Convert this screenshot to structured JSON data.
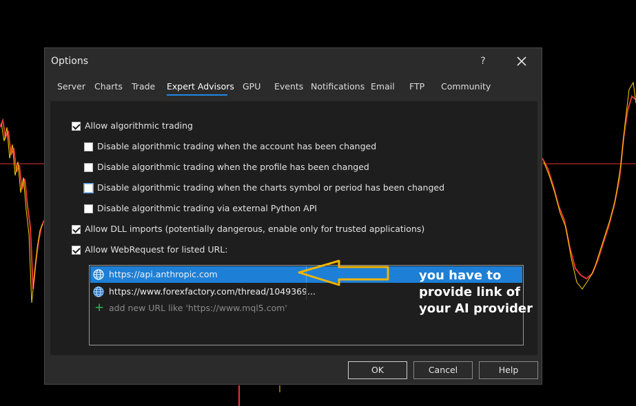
{
  "dialog": {
    "title": "Options",
    "help_label": "?",
    "tabs": [
      {
        "label": "Server"
      },
      {
        "label": "Charts"
      },
      {
        "label": "Trade"
      },
      {
        "label": "Expert Advisors",
        "active": true
      },
      {
        "label": "GPU"
      },
      {
        "label": "Events"
      },
      {
        "label": "Notifications"
      },
      {
        "label": "Email"
      },
      {
        "label": "FTP"
      },
      {
        "label": "Community"
      }
    ]
  },
  "options": [
    {
      "label": "Allow algorithmic trading",
      "checked": true
    },
    {
      "label": "Disable algorithmic trading when the account has been changed",
      "checked": false
    },
    {
      "label": "Disable algorithmic trading when the profile has been changed",
      "checked": false
    },
    {
      "label": "Disable algorithmic trading when the charts symbol or period has been changed",
      "checked": false
    },
    {
      "label": "Disable algorithmic trading via external Python API",
      "checked": false
    },
    {
      "label": "Allow DLL imports (potentially dangerous, enable only for trusted applications)",
      "checked": true
    },
    {
      "label": "Allow WebRequest for listed URL:",
      "checked": true
    }
  ],
  "url_list": {
    "items": [
      {
        "url": "https://api.anthropic.com",
        "selected": true
      },
      {
        "url": "https://www.forexfactory.com/thread/1049369...",
        "selected": false
      }
    ],
    "placeholder": "add new URL like 'https://www.mql5.com'"
  },
  "buttons": {
    "ok": "OK",
    "cancel": "Cancel",
    "help": "Help"
  },
  "annotation": {
    "lines": [
      "you have to",
      "provide link of",
      "your AI provider"
    ],
    "arrow_color": "#f0b400"
  },
  "colors": {
    "accent": "#1e88e5",
    "selection": "#1e7fd6",
    "chart_line": "#e53935",
    "chart_wick": "#ffd600"
  }
}
